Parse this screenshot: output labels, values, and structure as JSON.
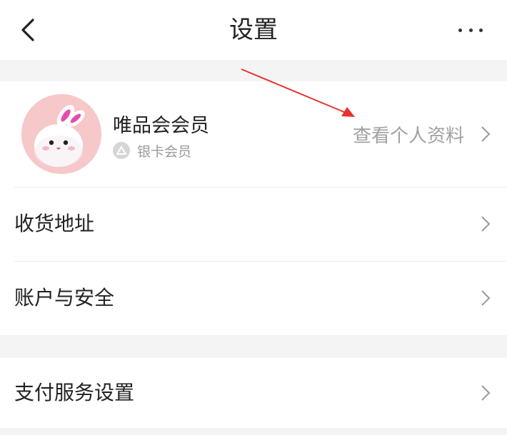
{
  "header": {
    "title": "设置",
    "back_icon": "chevron-left-icon",
    "more_icon": "more-horizontal-icon"
  },
  "profile": {
    "name": "唯品会会员",
    "member_level": "银卡会员",
    "view_profile_label": "查看个人资料",
    "avatar_bg": "#f6c8ca"
  },
  "menu": {
    "items": [
      {
        "label": "收货地址"
      },
      {
        "label": "账户与安全"
      }
    ]
  },
  "payment": {
    "label": "支付服务设置"
  },
  "colors": {
    "annotation_arrow": "#e8322f",
    "page_bg": "#f4f4f4"
  }
}
